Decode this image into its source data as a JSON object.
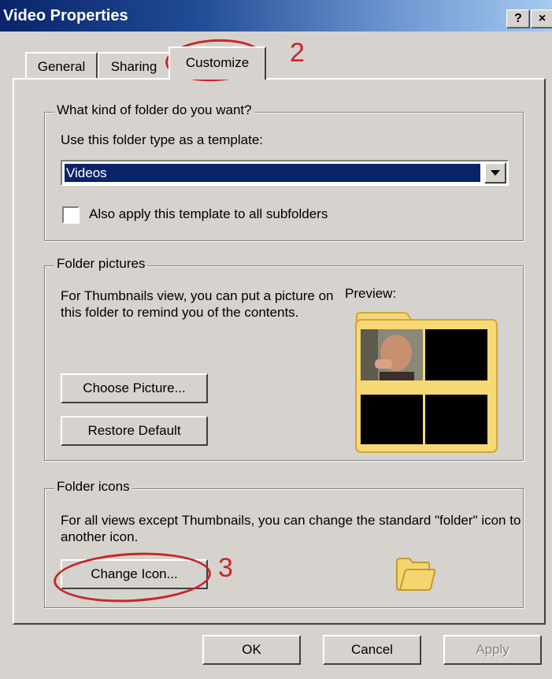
{
  "window": {
    "title": "Video Properties",
    "help_button": "?",
    "close_button": "×"
  },
  "tabs": [
    {
      "label": "General"
    },
    {
      "label": "Sharing"
    },
    {
      "label": "Customize"
    }
  ],
  "folder_type": {
    "legend": "What kind of folder do you want?",
    "prompt": "Use this folder type as a template:",
    "selected": "Videos",
    "apply_label": "Also apply this template to all subfolders",
    "apply_checked": false
  },
  "folder_pictures": {
    "legend": "Folder pictures",
    "description": "For Thumbnails view, you can put a picture on this folder to remind you of the contents.",
    "preview_label": "Preview:",
    "choose_label": "Choose Picture...",
    "restore_label": "Restore Default"
  },
  "folder_icons": {
    "legend": "Folder icons",
    "description": "For all views except Thumbnails, you can change the standard \"folder\" icon to another icon.",
    "change_label": "Change Icon..."
  },
  "footer": {
    "ok_label": "OK",
    "cancel_label": "Cancel",
    "apply_label": "Apply"
  },
  "annotations": {
    "step_tab": "2",
    "step_button": "3"
  },
  "colors": {
    "selection": "#0a246a",
    "annotation": "#c8262b",
    "face": "#d6d3ce"
  },
  "icons": [
    "help-icon",
    "close-icon",
    "dropdown-arrow-icon",
    "folder-preview-icon",
    "folder-icon"
  ]
}
